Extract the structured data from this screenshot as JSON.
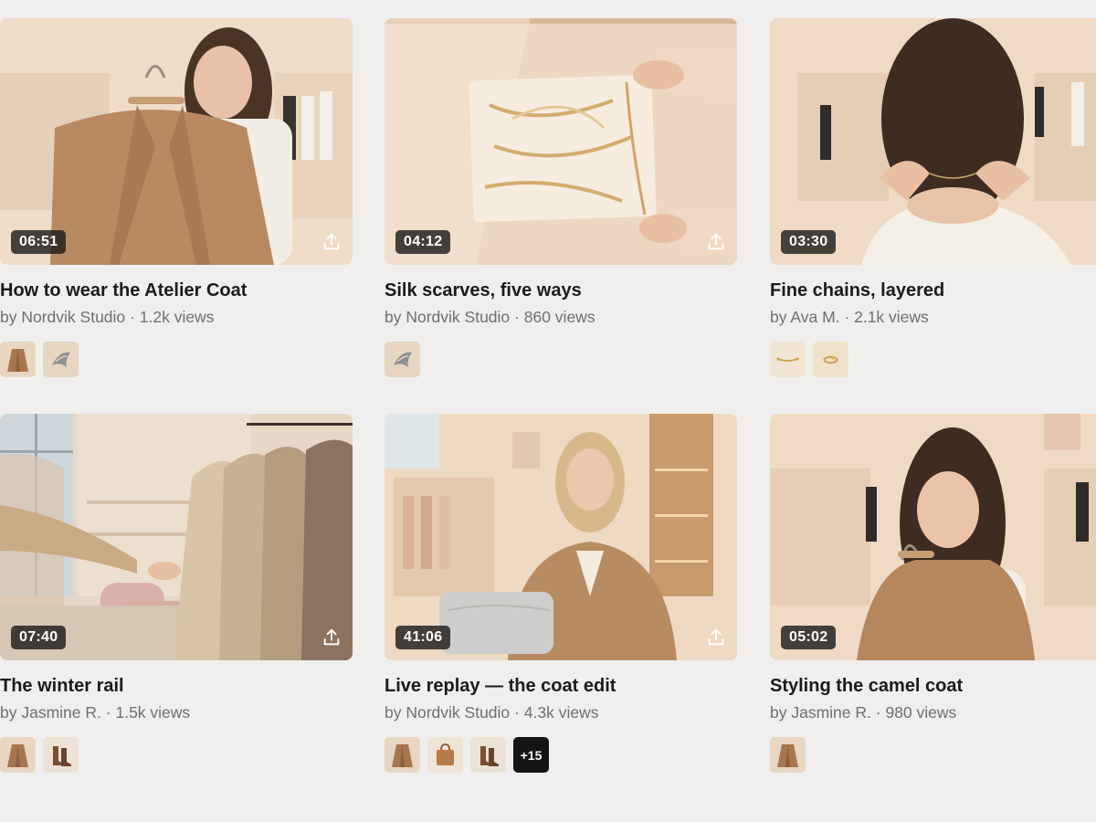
{
  "videos": [
    {
      "title": "How to wear the Atelier Coat",
      "author": "Nordvik Studio",
      "views": "1.2k views",
      "duration": "06:51",
      "products": [
        {
          "icon": "coat-icon"
        },
        {
          "icon": "scarf-icon"
        }
      ]
    },
    {
      "title": "Silk scarves, five ways",
      "author": "Nordvik Studio",
      "views": "860 views",
      "duration": "04:12",
      "products": [
        {
          "icon": "scarf-icon"
        }
      ]
    },
    {
      "title": "Fine chains, layered",
      "author": "Ava M.",
      "views": "2.1k views",
      "duration": "03:30",
      "products": [
        {
          "icon": "chain-icon"
        },
        {
          "icon": "ring-icon"
        }
      ]
    },
    {
      "title": "The winter rail",
      "author": "Jasmine R.",
      "views": "1.5k views",
      "duration": "07:40",
      "products": [
        {
          "icon": "coat-icon"
        },
        {
          "icon": "boots-icon"
        }
      ]
    },
    {
      "title": "Live replay — the coat edit",
      "author": "Nordvik Studio",
      "views": "4.3k views",
      "duration": "41:06",
      "products": [
        {
          "icon": "coat-icon"
        },
        {
          "icon": "bag-icon"
        },
        {
          "icon": "boots-icon"
        }
      ],
      "more": "+15"
    },
    {
      "title": "Styling the camel coat",
      "author": "Jasmine R.",
      "views": "980 views",
      "duration": "05:02",
      "products": [
        {
          "icon": "coat-icon"
        }
      ]
    }
  ],
  "meta_prefix": "by",
  "meta_separator": "·",
  "colors": {
    "background": "#f0efed",
    "badge": "#1e1c1a",
    "more_badge": "#141414",
    "title": "#1b1b1b",
    "meta": "#6f6f6f"
  }
}
